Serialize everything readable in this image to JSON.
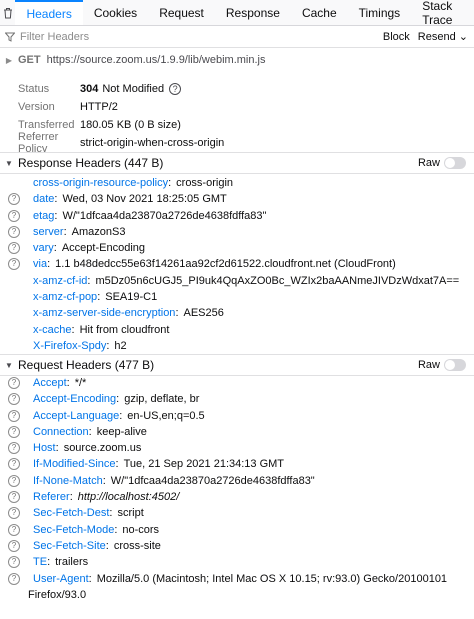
{
  "tabs": [
    "Headers",
    "Cookies",
    "Request",
    "Response",
    "Cache",
    "Timings",
    "Stack Trace"
  ],
  "filter": {
    "placeholder": "Filter Headers",
    "block_label": "Block",
    "resend_label": "Resend"
  },
  "request": {
    "method": "GET",
    "url": "https://source.zoom.us/1.9.9/lib/webim.min.js"
  },
  "summary": [
    {
      "label": "Status",
      "code": "304",
      "value": "Not Modified"
    },
    {
      "label": "Version",
      "value": "HTTP/2"
    },
    {
      "label": "Transferred",
      "value": "180.05 KB (0 B size)"
    },
    {
      "label": "Referrer Policy",
      "value": "strict-origin-when-cross-origin"
    }
  ],
  "response_section": {
    "title": "Response Headers (447 B)",
    "raw_label": "Raw"
  },
  "response_headers": [
    {
      "name": "cross-origin-resource-policy",
      "value": "cross-origin",
      "icon": false
    },
    {
      "name": "date",
      "value": "Wed, 03 Nov 2021 18:25:05 GMT",
      "icon": true
    },
    {
      "name": "etag",
      "value": "W/\"1dfcaa4da23870a2726de4638fdffa83\"",
      "icon": true
    },
    {
      "name": "server",
      "value": "AmazonS3",
      "icon": true
    },
    {
      "name": "vary",
      "value": "Accept-Encoding",
      "icon": true
    },
    {
      "name": "via",
      "value": "1.1 b48dedcc55e63f14261aa92cf2d61522.cloudfront.net (CloudFront)",
      "icon": true
    },
    {
      "name": "x-amz-cf-id",
      "value": "m5Dz05n6cUGJ5_PI9uk4QqAxZO0Bc_WZIx2baAANmeJIVDzWdxat7A==",
      "icon": false
    },
    {
      "name": "x-amz-cf-pop",
      "value": "SEA19-C1",
      "icon": false
    },
    {
      "name": "x-amz-server-side-encryption",
      "value": "AES256",
      "icon": false
    },
    {
      "name": "x-cache",
      "value": "Hit from cloudfront",
      "icon": false
    },
    {
      "name": "X-Firefox-Spdy",
      "value": "h2",
      "icon": false
    }
  ],
  "request_section": {
    "title": "Request Headers (477 B)",
    "raw_label": "Raw"
  },
  "request_headers": [
    {
      "name": "Accept",
      "value": "*/*"
    },
    {
      "name": "Accept-Encoding",
      "value": "gzip, deflate, br"
    },
    {
      "name": "Accept-Language",
      "value": "en-US,en;q=0.5"
    },
    {
      "name": "Connection",
      "value": "keep-alive"
    },
    {
      "name": "Host",
      "value": "source.zoom.us"
    },
    {
      "name": "If-Modified-Since",
      "value": "Tue, 21 Sep 2021 21:34:13 GMT"
    },
    {
      "name": "If-None-Match",
      "value": "W/\"1dfcaa4da23870a2726de4638fdffa83\""
    },
    {
      "name": "Referer",
      "value": "http://localhost:4502/"
    },
    {
      "name": "Sec-Fetch-Dest",
      "value": "script"
    },
    {
      "name": "Sec-Fetch-Mode",
      "value": "no-cors"
    },
    {
      "name": "Sec-Fetch-Site",
      "value": "cross-site"
    },
    {
      "name": "TE",
      "value": "trailers"
    },
    {
      "name": "User-Agent",
      "value": "Mozilla/5.0 (Macintosh; Intel Mac OS X 10.15; rv:93.0) Gecko/20100101 Firefox/93.0"
    }
  ]
}
